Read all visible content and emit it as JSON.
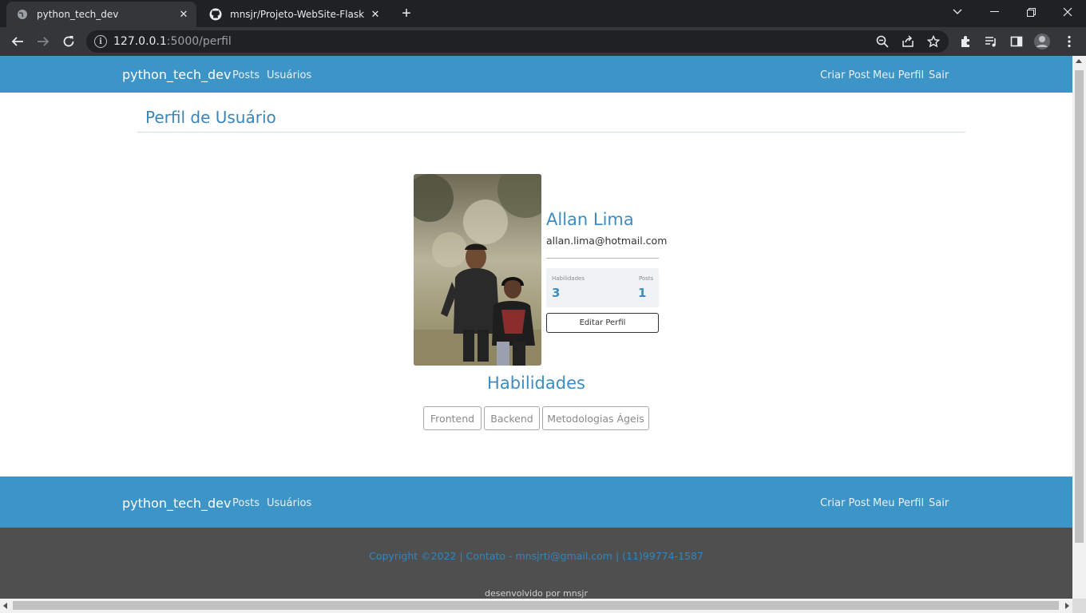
{
  "browser": {
    "tabs": [
      {
        "title": "python_tech_dev",
        "icon": "globe-icon",
        "active": true
      },
      {
        "title": "mnsjr/Projeto-WebSite-Flask",
        "icon": "github-icon",
        "active": false
      }
    ],
    "url_host": "127.0.0.1",
    "url_rest": ":5000/perfil"
  },
  "navbar": {
    "brand": "python_tech_dev",
    "left_links": [
      "Posts",
      "Usuários"
    ],
    "right_links": [
      "Criar Post",
      "Meu Perfil",
      "Sair"
    ]
  },
  "page": {
    "title": "Perfil de Usuário"
  },
  "profile": {
    "name": "Allan Lima",
    "email": "allan.lima@hotmail.com",
    "stats": {
      "skills_label": "Habilidades",
      "skills_value": "3",
      "posts_label": "Posts",
      "posts_value": "1"
    },
    "edit_label": "Editar Perfil"
  },
  "skills": {
    "title": "Habilidades",
    "items": [
      "Frontend",
      "Backend",
      "Metodologias Ágeis"
    ]
  },
  "footer": {
    "brand": "python_tech_dev",
    "left_links": [
      "Posts",
      "Usuários"
    ],
    "right_links": [
      "Criar Post",
      "Meu Perfil",
      "Sair"
    ],
    "copyright": "Copyright ©2022 | Contato - mnsjrti@gmail.com | (11)99774-1587",
    "developed_by": "desenvolvido por mnsjr"
  },
  "colors": {
    "primary": "#3d94c6",
    "accent_text": "#3d8cc2",
    "footer_dark": "#4f4f4f"
  }
}
